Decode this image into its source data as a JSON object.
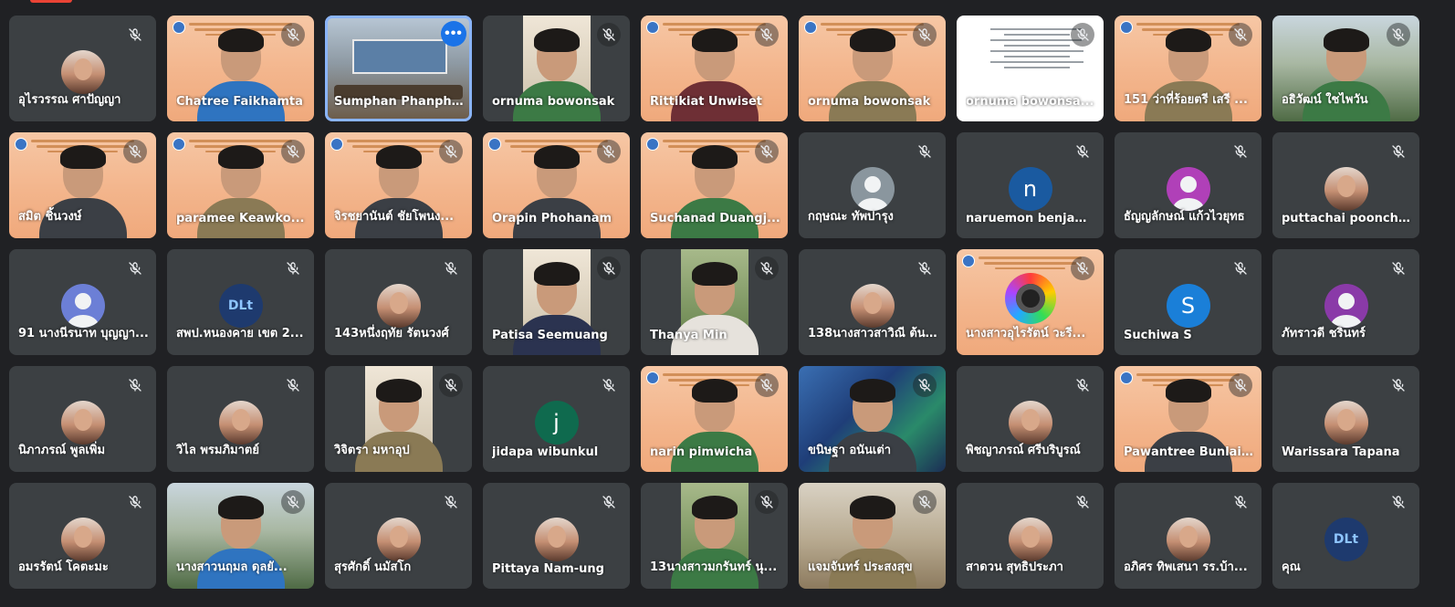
{
  "participants": [
    {
      "name": "อุไรวรรณ ศาปัญญา",
      "bg": "avatar-photo"
    },
    {
      "name": "Chatree Faikhamta",
      "bg": "banner",
      "person": "c-blue"
    },
    {
      "name": "Sumphan Phanphi...",
      "bg": "room",
      "active": true,
      "more": "•••"
    },
    {
      "name": "ornuma bowonsak",
      "bg": "strip-beige",
      "person": "c-green"
    },
    {
      "name": "Rittikiat Unwiset",
      "bg": "banner",
      "person": "c-maroon"
    },
    {
      "name": "ornuma bowonsak",
      "bg": "banner",
      "person": "c-khaki"
    },
    {
      "name": "ornuma bowonsa...",
      "bg": "doc"
    },
    {
      "name": "151 ว่าที่ร้อยตรี เสรี ...",
      "bg": "banner",
      "person": "c-khaki"
    },
    {
      "name": "อธิวัฒน์ ใชไพวัน",
      "bg": "outdoor",
      "person": "c-green"
    },
    {
      "name": "สมิต ชิ้นวงษ์",
      "bg": "banner",
      "person": "c-dark"
    },
    {
      "name": "paramee Keawko...",
      "bg": "banner",
      "person": "c-khaki"
    },
    {
      "name": "จิรชยานันต์ ชัยโพนง...",
      "bg": "banner",
      "person": "c-dark"
    },
    {
      "name": "Orapin Phohanam",
      "bg": "banner",
      "person": "c-dark"
    },
    {
      "name": "Suchanad Duangj...",
      "bg": "banner",
      "person": "c-green"
    },
    {
      "name": "กฤษณะ ทัพปารุง",
      "bg": "avatar-generic",
      "color": "#8a969e"
    },
    {
      "name": "naruemon benjamat",
      "bg": "avatar-letter",
      "letter": "n",
      "color": "#1a5aa0"
    },
    {
      "name": "ธัญญลักษณ์ แก้วไวยุทธ",
      "bg": "avatar-generic",
      "color": "#b040b8"
    },
    {
      "name": "puttachai poonchai...",
      "bg": "avatar-photo"
    },
    {
      "name": "91 นางนีรนาท บุญญา...",
      "bg": "avatar-generic",
      "color": "#6c7fd6"
    },
    {
      "name": "สพป.หนองคาย เขต 2...",
      "bg": "avatar-logo",
      "letter": "DLt"
    },
    {
      "name": "143หนึ่งฤทัย รัตนวงศ์",
      "bg": "avatar-photo"
    },
    {
      "name": "Patisa Seemuang",
      "bg": "strip-beige",
      "person": "c-navy"
    },
    {
      "name": "Thanya Min",
      "bg": "strip-green",
      "person": "c-white"
    },
    {
      "name": "138นางสาวสาวิณี ต้น...",
      "bg": "avatar-photo"
    },
    {
      "name": "นางสาวอุไรรัตน์ วะรี...",
      "bg": "banner-logo"
    },
    {
      "name": "Suchiwa S",
      "bg": "avatar-letter",
      "letter": "S",
      "color": "#1a7fd8"
    },
    {
      "name": "ภัทราวดี ชรินทร์",
      "bg": "avatar-generic",
      "color": "#8a3aa8"
    },
    {
      "name": "นิภาภรณ์ พูลเพิ่ม",
      "bg": "avatar-photo"
    },
    {
      "name": "วิไล พรมภิมาตย์",
      "bg": "avatar-photo"
    },
    {
      "name": "วิจิตรา มหาอุป",
      "bg": "strip-beige",
      "person": "c-khaki"
    },
    {
      "name": "jidapa wibunkul",
      "bg": "avatar-letter",
      "letter": "j",
      "color": "#0f6a4e"
    },
    {
      "name": "narin pimwicha",
      "bg": "banner",
      "person": "c-green"
    },
    {
      "name": "ขนิษฐา อนันเต่า",
      "bg": "game",
      "person": "c-dark"
    },
    {
      "name": "พิชญาภรณ์ ศรีบริบูรณ์",
      "bg": "avatar-photo"
    },
    {
      "name": "Pawantree Bunlaing",
      "bg": "banner",
      "person": "c-dark"
    },
    {
      "name": "Warissara Tapana",
      "bg": "avatar-photo"
    },
    {
      "name": "อมรรัตน์ โคตะมะ",
      "bg": "avatar-photo"
    },
    {
      "name": "นางสาวนฤมล ดุลยั...",
      "bg": "outdoor",
      "person": "c-blue"
    },
    {
      "name": "สุรศักดิ์ นมัสโก",
      "bg": "avatar-photo"
    },
    {
      "name": "Pittaya Nam-ung",
      "bg": "avatar-photo"
    },
    {
      "name": "13นางสาวมกรันทร์ นุ...",
      "bg": "strip-green",
      "person": "c-green"
    },
    {
      "name": "แจมจันทร์ ประสงสุข",
      "bg": "kitchen",
      "person": "c-khaki"
    },
    {
      "name": "สาดวน สุทธิประภา",
      "bg": "avatar-photo"
    },
    {
      "name": "อภิศร ทิพเสนา รร.บ้า...",
      "bg": "avatar-photo"
    },
    {
      "name": "คุณ",
      "bg": "avatar-logo",
      "letter": "DLt"
    }
  ],
  "colors": {
    "background": "#202124",
    "tile": "#3c4043",
    "active_border": "#8ab4f8",
    "more_button": "#1a73e8"
  },
  "icons": {
    "mute": "mic-off-icon",
    "more": "more-horizontal-icon"
  }
}
